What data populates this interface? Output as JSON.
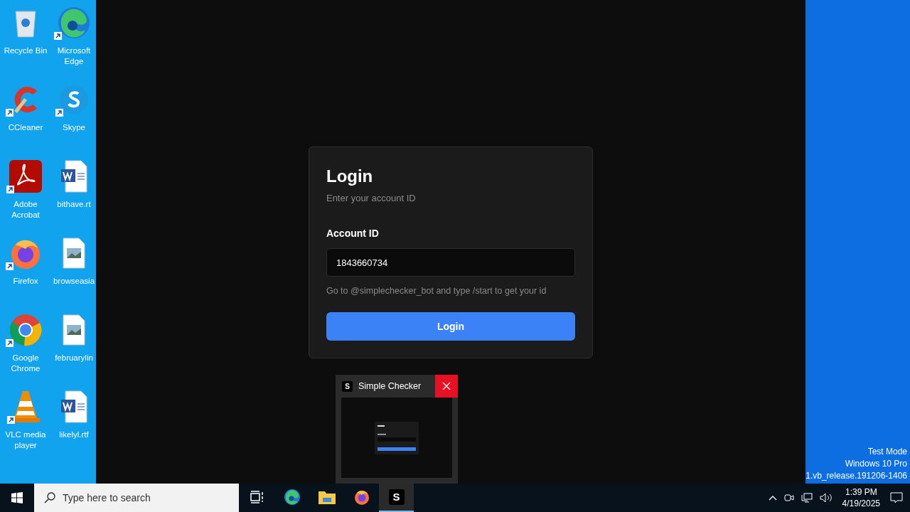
{
  "desktop_icons": [
    {
      "label": "Recycle Bin",
      "kind": "recycle",
      "shortcut": false
    },
    {
      "label": "Microsoft Edge",
      "kind": "edge",
      "shortcut": true
    },
    {
      "label": "CCleaner",
      "kind": "ccleaner",
      "shortcut": true
    },
    {
      "label": "Skype",
      "kind": "skype",
      "shortcut": true
    },
    {
      "label": "Adobe Acrobat",
      "kind": "acrobat",
      "shortcut": true
    },
    {
      "label": "bithave.rt",
      "kind": "word",
      "shortcut": false
    },
    {
      "label": "Firefox",
      "kind": "firefox",
      "shortcut": true
    },
    {
      "label": "browseasia",
      "kind": "image",
      "shortcut": false
    },
    {
      "label": "Google Chrome",
      "kind": "chrome",
      "shortcut": true
    },
    {
      "label": "februarylin",
      "kind": "image",
      "shortcut": false
    },
    {
      "label": "VLC media player",
      "kind": "vlc",
      "shortcut": true
    },
    {
      "label": "likelyl.rtf",
      "kind": "word",
      "shortcut": false
    }
  ],
  "login": {
    "title": "Login",
    "subtitle": "Enter your account ID",
    "field_label": "Account ID",
    "value": "1843660734",
    "hint": "Go to @simplechecker_bot and type /start to get your id",
    "button": "Login"
  },
  "taskbar_preview": {
    "app_letter": "S",
    "title": "Simple Checker"
  },
  "watermark": [
    "Test Mode",
    "Windows 10 Pro",
    "1.vb_release.191206-1406"
  ],
  "taskbar": {
    "search_placeholder": "Type here to search",
    "apps": [
      {
        "kind": "taskview",
        "selected": false
      },
      {
        "kind": "edge",
        "selected": false
      },
      {
        "kind": "explorer",
        "selected": false
      },
      {
        "kind": "firefox",
        "selected": false
      },
      {
        "kind": "checker",
        "letter": "S",
        "selected": true
      }
    ],
    "time": "1:39 PM",
    "date": "4/19/2025"
  }
}
